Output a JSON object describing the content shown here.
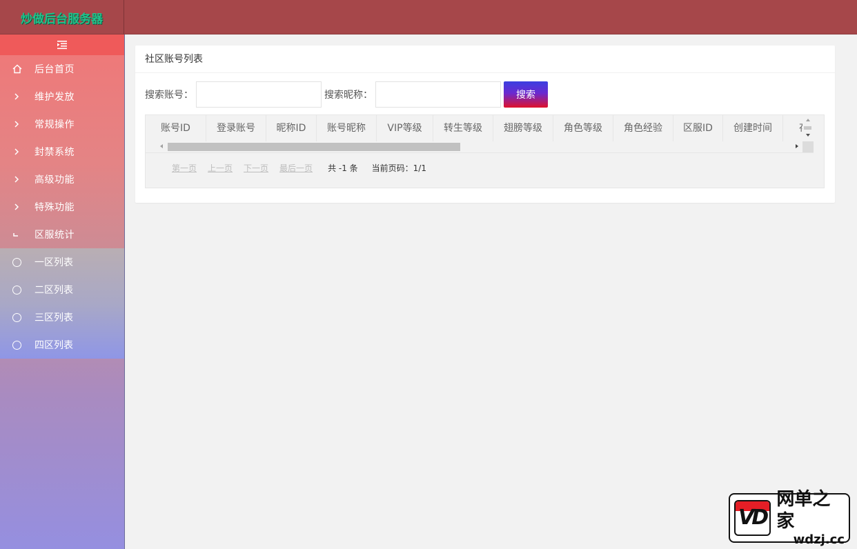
{
  "header": {
    "logo": "炒做后台服务器"
  },
  "sidebar": {
    "toggle_icon": "indent-icon",
    "items": [
      {
        "label": "后台首页",
        "icon": "home-icon"
      },
      {
        "label": "维护发放",
        "icon": "chevron-right-icon"
      },
      {
        "label": "常规操作",
        "icon": "chevron-right-icon"
      },
      {
        "label": "封禁系统",
        "icon": "chevron-right-icon"
      },
      {
        "label": "高级功能",
        "icon": "chevron-right-icon"
      },
      {
        "label": "特殊功能",
        "icon": "chevron-right-icon"
      },
      {
        "label": "区服统计",
        "icon": "chevron-down-icon"
      }
    ],
    "subitems": [
      {
        "label": "一区列表"
      },
      {
        "label": "二区列表"
      },
      {
        "label": "三区列表"
      },
      {
        "label": "四区列表"
      }
    ]
  },
  "main": {
    "card_title": "社区账号列表",
    "search": {
      "account_label": "搜索账号：",
      "account_value": "",
      "nickname_label": "搜索昵称：",
      "nickname_value": "",
      "button": "搜索"
    },
    "table": {
      "columns": [
        "账号ID",
        "登录账号",
        "昵称ID",
        "账号昵称",
        "VIP等级",
        "转生等级",
        "翅膀等级",
        "角色等级",
        "角色经验",
        "区服ID",
        "创建时间",
        "存"
      ]
    },
    "pager": {
      "first": "第一页",
      "prev": "上一页",
      "next": "下一页",
      "last": "最后一页",
      "total": "共 -1 条",
      "current": "当前页码：1/1"
    }
  },
  "badge": {
    "cn": "网单之家",
    "en": "wdzj.cc"
  }
}
